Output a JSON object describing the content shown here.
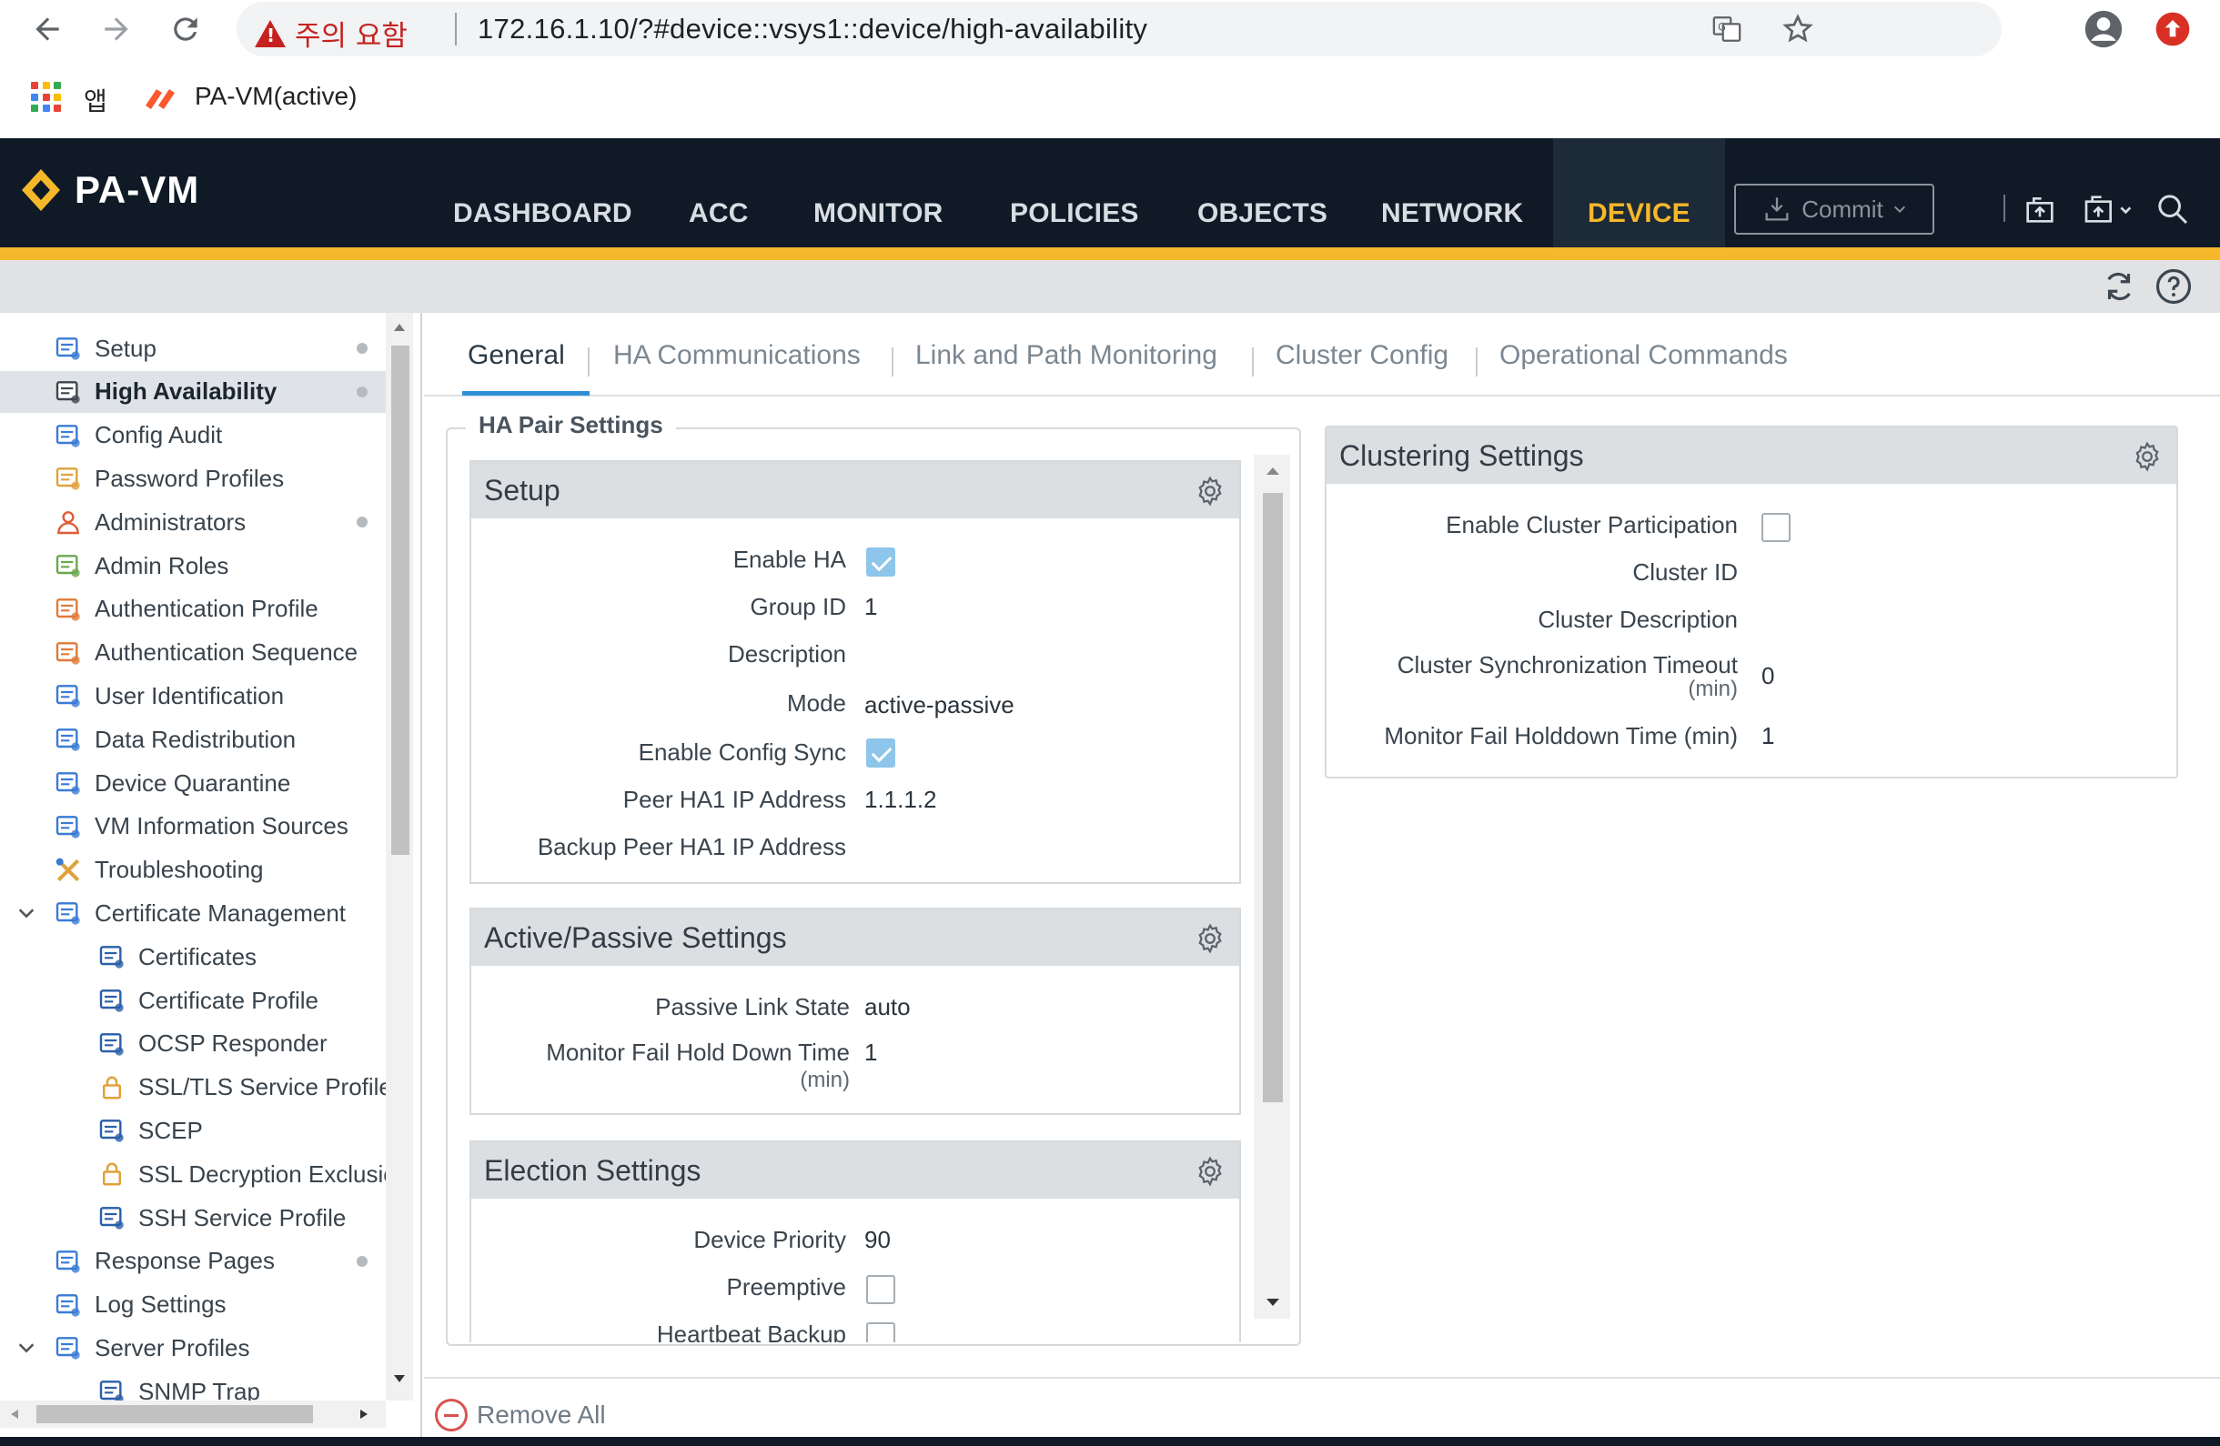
{
  "browser": {
    "warning": "주의 요함",
    "url": "172.16.1.10/?#device::vsys1::device/high-availability",
    "bookmarks": {
      "apps": "앱",
      "tab": "PA-VM(active)"
    }
  },
  "app": {
    "logo": "PA-VM",
    "nav": [
      "DASHBOARD",
      "ACC",
      "MONITOR",
      "POLICIES",
      "OBJECTS",
      "NETWORK",
      "DEVICE"
    ],
    "active_nav": "DEVICE",
    "commit": "Commit",
    "colors": {
      "header_bg": "#0f1a26",
      "accent": "#f5b82a",
      "link_blue": "#2d8fd6"
    }
  },
  "sidebar": {
    "items": [
      {
        "label": "Setup",
        "icon": "setup-icon",
        "dot": true
      },
      {
        "label": "High Availability",
        "icon": "high-availability-icon",
        "dot": true,
        "active": true
      },
      {
        "label": "Config Audit",
        "icon": "config-audit-icon"
      },
      {
        "label": "Password Profiles",
        "icon": "password-profiles-icon"
      },
      {
        "label": "Administrators",
        "icon": "administrators-icon",
        "dot": true
      },
      {
        "label": "Admin Roles",
        "icon": "admin-roles-icon"
      },
      {
        "label": "Authentication Profile",
        "icon": "authentication-profile-icon"
      },
      {
        "label": "Authentication Sequence",
        "icon": "authentication-sequence-icon"
      },
      {
        "label": "User Identification",
        "icon": "user-identification-icon"
      },
      {
        "label": "Data Redistribution",
        "icon": "data-redistribution-icon"
      },
      {
        "label": "Device Quarantine",
        "icon": "device-quarantine-icon"
      },
      {
        "label": "VM Information Sources",
        "icon": "vm-information-sources-icon"
      },
      {
        "label": "Troubleshooting",
        "icon": "troubleshooting-icon"
      },
      {
        "label": "Certificate Management",
        "icon": "certificate-management-icon",
        "expanded": true
      },
      {
        "label": "Certificates",
        "icon": "certificate-icon",
        "child": true
      },
      {
        "label": "Certificate Profile",
        "icon": "certificate-icon",
        "child": true
      },
      {
        "label": "OCSP Responder",
        "icon": "certificate-icon",
        "child": true
      },
      {
        "label": "SSL/TLS Service Profile",
        "icon": "lock-icon",
        "child": true
      },
      {
        "label": "SCEP",
        "icon": "scep-icon",
        "child": true
      },
      {
        "label": "SSL Decryption Exclusic",
        "icon": "lock-icon",
        "child": true
      },
      {
        "label": "SSH Service Profile",
        "icon": "certificate-icon",
        "child": true
      },
      {
        "label": "Response Pages",
        "icon": "response-pages-icon",
        "dot": true
      },
      {
        "label": "Log Settings",
        "icon": "log-settings-icon"
      },
      {
        "label": "Server Profiles",
        "icon": "server-profiles-icon",
        "expanded": true
      },
      {
        "label": "SNMP Trap",
        "icon": "snmp-trap-icon",
        "child": true
      }
    ]
  },
  "tabs": [
    "General",
    "HA Communications",
    "Link and Path Monitoring",
    "Cluster Config",
    "Operational Commands"
  ],
  "active_tab": "General",
  "ha_pair": {
    "legend": "HA Pair Settings",
    "setup": {
      "title": "Setup",
      "enable_ha_label": "Enable HA",
      "enable_ha": true,
      "group_id_label": "Group ID",
      "group_id": "1",
      "description_label": "Description",
      "description": "",
      "mode_label": "Mode",
      "mode": "active-passive",
      "config_sync_label": "Enable Config Sync",
      "config_sync": true,
      "peer_ha1_label": "Peer HA1 IP Address",
      "peer_ha1": "1.1.1.2",
      "backup_peer_label": "Backup Peer HA1 IP Address",
      "backup_peer": ""
    },
    "active_passive": {
      "title": "Active/Passive Settings",
      "passive_link_label": "Passive Link State",
      "passive_link": "auto",
      "hold_down_label": "Monitor Fail Hold Down Time",
      "hold_down_unit": "(min)",
      "hold_down": "1"
    },
    "election": {
      "title": "Election Settings",
      "priority_label": "Device Priority",
      "priority": "90",
      "preemptive_label": "Preemptive",
      "preemptive": false,
      "heartbeat_label": "Heartbeat Backup",
      "heartbeat": false
    }
  },
  "clustering": {
    "title": "Clustering Settings",
    "participation_label": "Enable Cluster Participation",
    "participation": false,
    "cluster_id_label": "Cluster ID",
    "cluster_id": "",
    "cluster_desc_label": "Cluster Description",
    "cluster_desc": "",
    "sync_timeout_label": "Cluster Synchronization Timeout",
    "sync_timeout_unit": "(min)",
    "sync_timeout": "0",
    "holddown_label": "Monitor Fail Holddown Time (min)",
    "holddown": "1"
  },
  "footer": {
    "remove_all": "Remove All"
  }
}
